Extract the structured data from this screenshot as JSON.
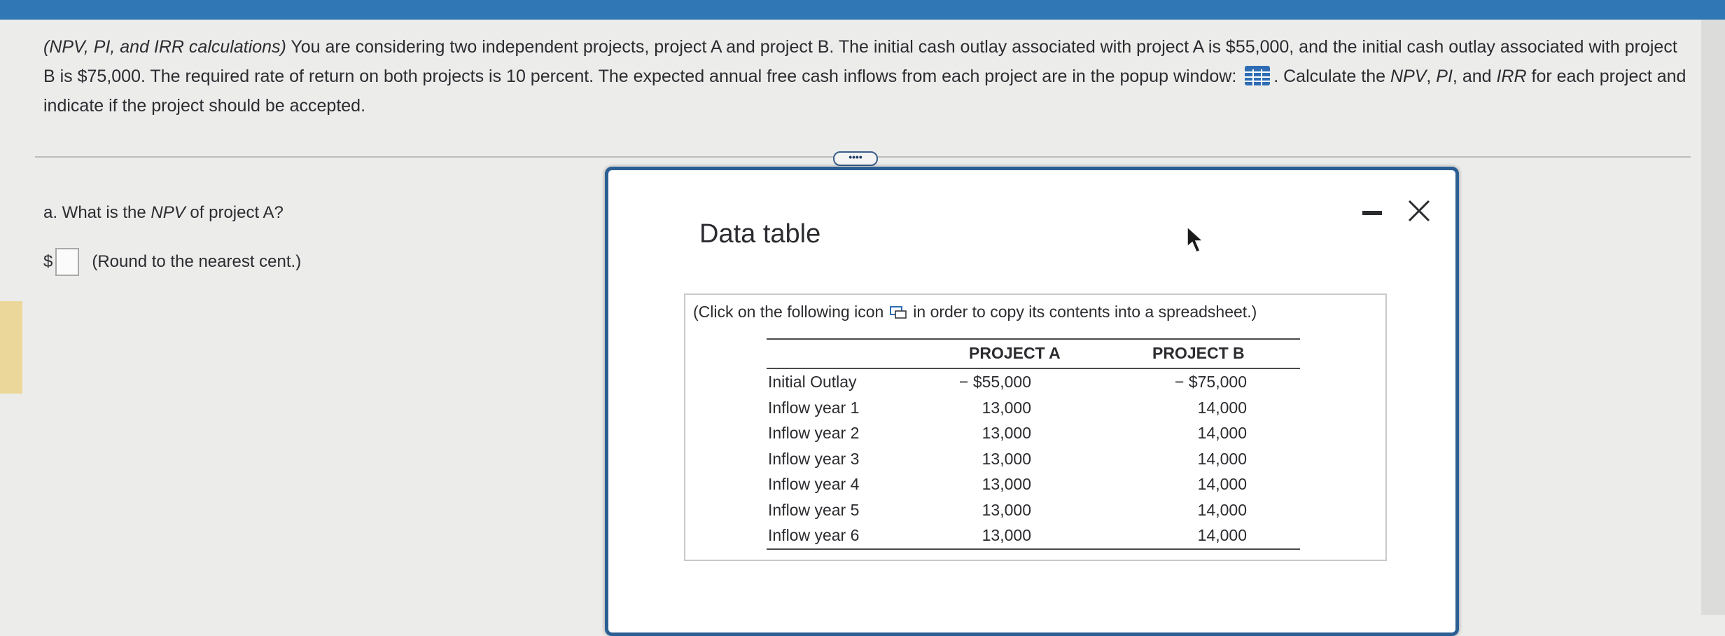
{
  "question": {
    "topic": "(NPV, PI, and IRR calculations)",
    "text_1": " You are considering two independent projects, project A and project B. The initial cash outlay associated with project A is $55,000, and the initial cash outlay associated with project B is $75,000. The required rate of return on both projects is 10 percent. The expected annual free cash inflows from each project are in the popup window: ",
    "text_2": ". Calculate the ",
    "npv": "NPV",
    "comma1": ", ",
    "pi": "PI",
    "and": ", and ",
    "irr": "IRR",
    "text_3": " for each project and indicate if the project should be accepted."
  },
  "more_button": "••••",
  "part_a": {
    "prefix": "a. What is the ",
    "npv": "NPV",
    "suffix": " of project A?",
    "currency": "$",
    "input_value": "",
    "hint": "(Round to the nearest cent.)"
  },
  "popup": {
    "title": "Data table",
    "copy_note_1": "(Click on the following icon",
    "copy_note_2": "in order to copy its contents into a spreadsheet.)",
    "table": {
      "headers": [
        "PROJECT A",
        "PROJECT B"
      ],
      "rows": [
        {
          "label": "Initial Outlay",
          "a": "− $55,000",
          "b": "− $75,000"
        },
        {
          "label": "Inflow year 1",
          "a": "13,000",
          "b": "14,000"
        },
        {
          "label": "Inflow year 2",
          "a": "13,000",
          "b": "14,000"
        },
        {
          "label": "Inflow year 3",
          "a": "13,000",
          "b": "14,000"
        },
        {
          "label": "Inflow year 4",
          "a": "13,000",
          "b": "14,000"
        },
        {
          "label": "Inflow year 5",
          "a": "13,000",
          "b": "14,000"
        },
        {
          "label": "Inflow year 6",
          "a": "13,000",
          "b": "14,000"
        }
      ]
    }
  },
  "colors": {
    "accent": "#2f78b5",
    "popup_border": "#2b5f94",
    "icon_blue": "#2e6db4"
  },
  "icons": [
    "grid-table-icon",
    "copy-spreadsheet-icon",
    "minimize-icon",
    "close-icon",
    "mouse-cursor-icon"
  ]
}
